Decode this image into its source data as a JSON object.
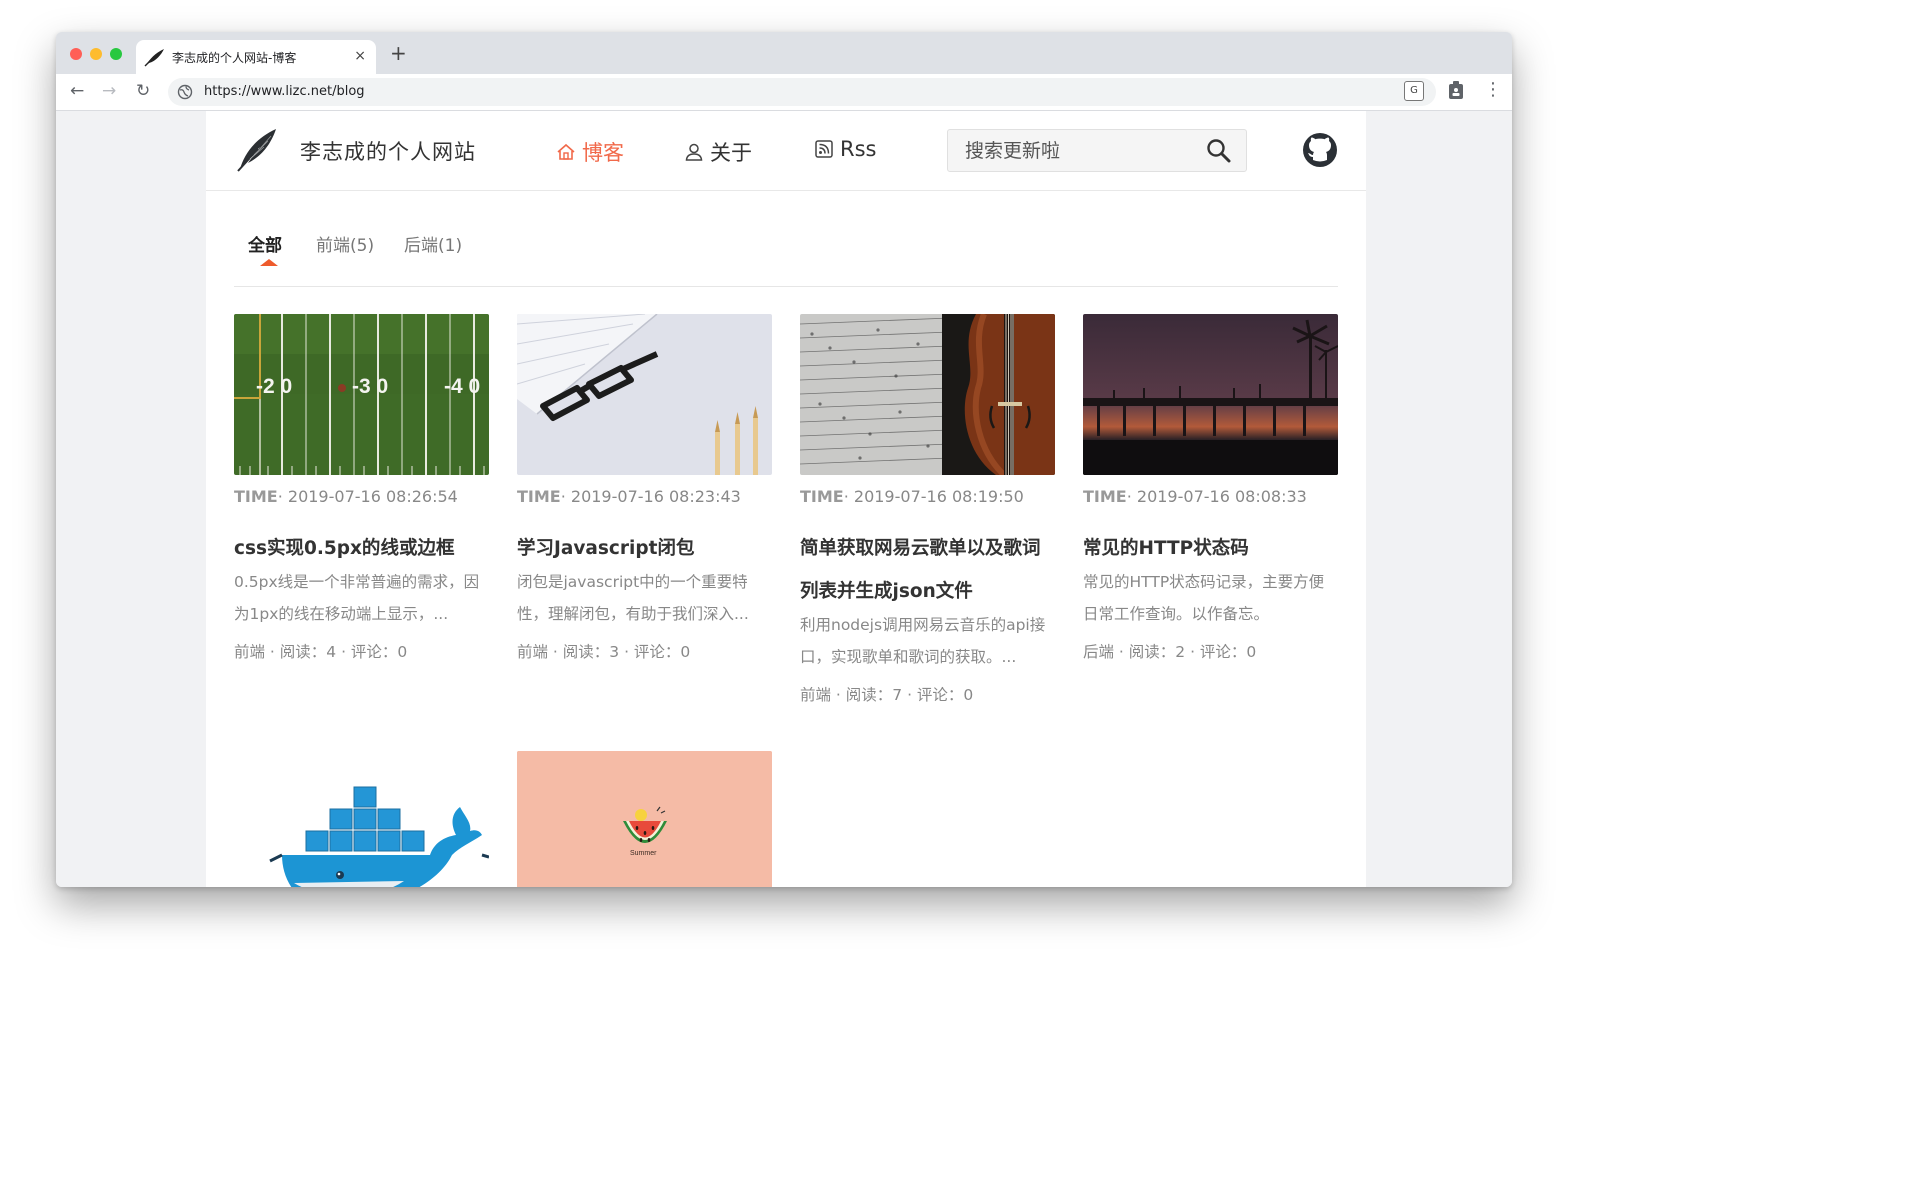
{
  "browser": {
    "tab_title": "李志成的个人网站-博客",
    "close_glyph": "×",
    "new_tab_glyph": "+",
    "back_glyph": "←",
    "forward_glyph": "→",
    "reload_glyph": "↻",
    "url": "https://www.lizc.net/blog",
    "menu_glyph": "⋮"
  },
  "header": {
    "site_name": "李志成的个人网站",
    "nav": {
      "blog": "博客",
      "about": "关于",
      "rss": "Rss"
    },
    "search_placeholder": "搜索更新啦"
  },
  "categories": [
    {
      "label": "全部",
      "active": true
    },
    {
      "label": "前端(5)",
      "active": false
    },
    {
      "label": "后端(1)",
      "active": false
    }
  ],
  "posts": [
    {
      "time_label": "TIME",
      "time": "· 2019-07-16 08:26:54",
      "title": "css实现0.5px的线或边框",
      "desc": "0.5px线是一个非常普遍的需求，因为1px的线在移动端上显示，...",
      "stats": "前端 · 阅读：4 · 评论：0",
      "image": "football-field"
    },
    {
      "time_label": "TIME",
      "time": "· 2019-07-16 08:23:43",
      "title": "学习Javascript闭包",
      "desc": "闭包是javascript中的一个重要特性，理解闭包，有助于我们深入...",
      "stats": "前端 · 阅读：3 · 评论：0",
      "image": "glasses-desk"
    },
    {
      "time_label": "TIME",
      "time": "· 2019-07-16 08:19:50",
      "title": "简单获取网易云歌单以及歌词列表并生成json文件",
      "desc": "利用nodejs调用网易云音乐的api接口，实现歌单和歌词的获取。...",
      "stats": "前端 · 阅读：7 · 评论：0",
      "image": "violin-sheet-music"
    },
    {
      "time_label": "TIME",
      "time": "· 2019-07-16 08:08:33",
      "title": "常见的HTTP状态码",
      "desc": "常见的HTTP状态码记录，主要方便日常工作查询。以作备忘。",
      "stats": "后端 · 阅读：2 · 评论：0",
      "image": "pier-sunset"
    },
    {
      "image": "docker-whale"
    },
    {
      "image": "watermelon-summer",
      "image_caption": "Summer"
    }
  ],
  "colors": {
    "accent": "#f1694a",
    "marker": "#ee5b2c",
    "page_bg": "#f1f2f4"
  },
  "icons": [
    "feather-logo-icon",
    "home-icon",
    "user-icon",
    "rss-icon",
    "search-icon",
    "github-icon",
    "globe-icon",
    "translate-icon",
    "extension-icon"
  ]
}
